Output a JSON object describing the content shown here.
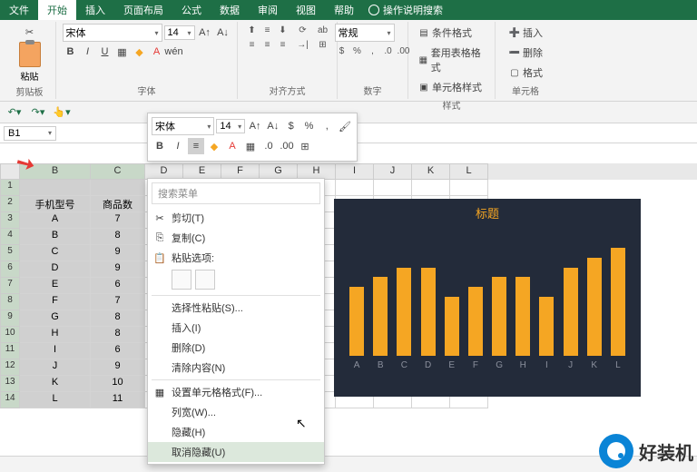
{
  "tabs": {
    "file": "文件",
    "home": "开始",
    "insert": "插入",
    "layout": "页面布局",
    "formula": "公式",
    "data": "数据",
    "review": "审阅",
    "view": "视图",
    "help": "帮助",
    "tell_me": "操作说明搜索"
  },
  "ribbon": {
    "paste": "粘贴",
    "clipboard_group": "剪贴板",
    "font_name": "宋体",
    "font_size": "14",
    "font_group": "字体",
    "align_group": "对齐方式",
    "wrap": "ab",
    "merge": "合并",
    "number_format": "常规",
    "number_group": "数字",
    "cond_format": "条件格式",
    "table_format": "套用表格格式",
    "cell_styles": "单元格样式",
    "styles_group": "样式",
    "insert_btn": "插入",
    "delete_btn": "删除",
    "format_btn": "格式",
    "cells_group": "单元格"
  },
  "namebox": "B1",
  "float_toolbar": {
    "font": "宋体",
    "size": "14"
  },
  "context_menu": {
    "search_placeholder": "搜索菜单",
    "cut": "剪切(T)",
    "copy": "复制(C)",
    "paste_options": "粘贴选项:",
    "paste_special": "选择性粘贴(S)...",
    "insert": "插入(I)",
    "delete": "删除(D)",
    "clear": "清除内容(N)",
    "format_cells": "设置单元格格式(F)...",
    "col_width": "列宽(W)...",
    "hide": "隐藏(H)",
    "unhide": "取消隐藏(U)"
  },
  "columns": [
    "B",
    "C",
    "D",
    "E",
    "F",
    "G",
    "H",
    "I",
    "J",
    "K",
    "L"
  ],
  "col_widths": {
    "B": 78,
    "C": 60,
    "D": 42,
    "E": 42,
    "F": 42,
    "G": 42,
    "H": 42,
    "I": 42,
    "J": 42,
    "K": 42,
    "L": 42
  },
  "header_row": {
    "b": "手机型号",
    "c": "商品数"
  },
  "data_rows": [
    {
      "b": "A",
      "c": "7"
    },
    {
      "b": "B",
      "c": "8"
    },
    {
      "b": "C",
      "c": "9"
    },
    {
      "b": "D",
      "c": "9"
    },
    {
      "b": "E",
      "c": "6"
    },
    {
      "b": "F",
      "c": "7"
    },
    {
      "b": "G",
      "c": "8"
    },
    {
      "b": "H",
      "c": "8"
    },
    {
      "b": "I",
      "c": "6"
    },
    {
      "b": "J",
      "c": "9"
    },
    {
      "b": "K",
      "c": "10"
    },
    {
      "b": "L",
      "c": "11"
    }
  ],
  "chart_data": {
    "type": "bar",
    "title": "标题",
    "categories": [
      "A",
      "B",
      "C",
      "D",
      "E",
      "F",
      "G",
      "H",
      "I",
      "J",
      "K",
      "L"
    ],
    "values": [
      7,
      8,
      9,
      9,
      6,
      7,
      8,
      8,
      6,
      9,
      10,
      11
    ],
    "xlabel": "",
    "ylabel": "",
    "ylim": [
      0,
      12
    ]
  },
  "watermark": "好装机"
}
